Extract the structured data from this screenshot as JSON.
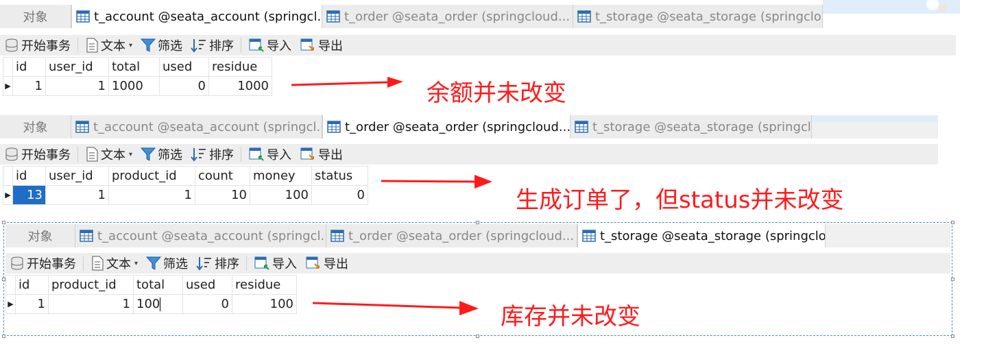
{
  "panels": [
    {
      "tabs": {
        "objects": "对象",
        "t_account": "t_account @seata_account (springcl...",
        "t_order": "t_order @seata_order (springcloud...",
        "t_storage": "t_storage @seata_storage (springclo...",
        "active": "t_account"
      },
      "toolbar": {
        "begin_tx": "开始事务",
        "text": "文本",
        "filter": "筛选",
        "sort": "排序",
        "import": "导入",
        "export": "导出"
      },
      "columns": [
        "id",
        "user_id",
        "total",
        "used",
        "residue"
      ],
      "row": [
        "1",
        "1",
        "1000",
        "0",
        "1000"
      ],
      "note": "余额并未改变"
    },
    {
      "tabs": {
        "objects": "对象",
        "t_account": "t_account @seata_account (springcl...",
        "t_order": "t_order @seata_order (springcloud...",
        "t_storage": "t_storage @seata_storage (springclo...",
        "active": "t_order"
      },
      "toolbar": {
        "begin_tx": "开始事务",
        "text": "文本",
        "filter": "筛选",
        "sort": "排序",
        "import": "导入",
        "export": "导出"
      },
      "columns": [
        "id",
        "user_id",
        "product_id",
        "count",
        "money",
        "status"
      ],
      "row": [
        "13",
        "1",
        "1",
        "10",
        "100",
        "0"
      ],
      "note": "生成订单了，但status并未改变"
    },
    {
      "tabs": {
        "objects": "对象",
        "t_account": "t_account @seata_account (springcl...",
        "t_order": "t_order @seata_order (springcloud...",
        "t_storage": "t_storage @seata_storage (springclo...",
        "active": "t_storage"
      },
      "toolbar": {
        "begin_tx": "开始事务",
        "text": "文本",
        "filter": "筛选",
        "sort": "排序",
        "import": "导入",
        "export": "导出"
      },
      "columns": [
        "id",
        "product_id",
        "total",
        "used",
        "residue"
      ],
      "row": [
        "1",
        "1",
        "100",
        "0",
        "100"
      ],
      "note": "库存并未改变"
    }
  ],
  "colors": {
    "annotation": "#ff1a1a",
    "selected_cell": "#1e6ec8",
    "selected_header": "#dbe9f7",
    "selection_border": "#3a8fb5"
  },
  "icons": [
    "table-icon",
    "database-icon",
    "document-icon",
    "funnel-icon",
    "sort-icon",
    "import-icon",
    "export-icon",
    "row-pointer-icon",
    "red-arrow-icon"
  ]
}
